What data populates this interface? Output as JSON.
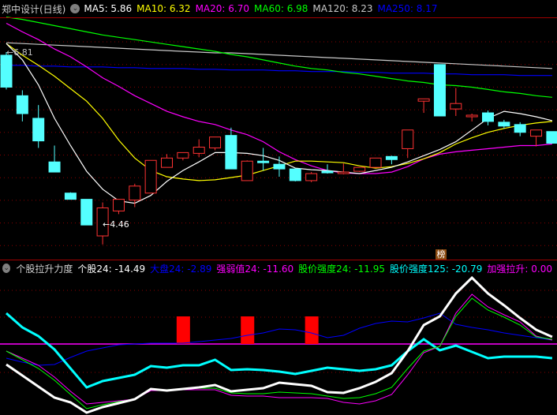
{
  "header": {
    "title": "郑中设计(日线)",
    "ma": [
      {
        "label": "MA5: 5.86",
        "color": "#ffffff"
      },
      {
        "label": "MA10: 6.32",
        "color": "#ffff00"
      },
      {
        "label": "MA20: 6.70",
        "color": "#ff00ff"
      },
      {
        "label": "MA60: 6.98",
        "color": "#00ff00"
      },
      {
        "label": "MA120: 8.23",
        "color": "#c8c8c8"
      },
      {
        "label": "MA250: 8.17",
        "color": "#0000ff"
      }
    ]
  },
  "indicator": {
    "title": "个股拉升力度",
    "items": [
      {
        "label": "个股24: -14.49",
        "color": "#ffffff"
      },
      {
        "label": "大盘24: -2.89",
        "color": "#0000ff"
      },
      {
        "label": "强弱值24: -11.60",
        "color": "#ff00ff"
      },
      {
        "label": "股价强度24: -11.95",
        "color": "#00ff00"
      },
      {
        "label": "股价强度125: -20.79",
        "color": "#00ffff"
      },
      {
        "label": "加强拉升: 0.00",
        "color": "#ff00ff"
      }
    ]
  },
  "labels": {
    "high": "←6.81",
    "low": "←4.46",
    "badge": "榜"
  },
  "colors": {
    "up": "#ff3232",
    "down": "#54ffff",
    "grid": "#8b0000"
  },
  "chart_data": [
    {
      "type": "candlestick",
      "title": "郑中设计(日线)",
      "price_high": 6.81,
      "price_low": 4.46,
      "candles": [
        [
          6.79,
          6.83,
          6.35,
          6.38
        ],
        [
          6.27,
          6.34,
          5.94,
          6.04
        ],
        [
          5.98,
          6.15,
          5.6,
          5.69
        ],
        [
          5.42,
          5.63,
          5.29,
          5.29
        ],
        [
          5.02,
          5.03,
          4.94,
          4.94
        ],
        [
          4.94,
          4.94,
          4.61,
          4.61
        ],
        [
          4.47,
          4.9,
          4.36,
          4.83
        ],
        [
          4.79,
          4.94,
          4.75,
          4.94
        ],
        [
          4.93,
          5.14,
          4.84,
          5.11
        ],
        [
          5.02,
          5.44,
          5.02,
          5.44
        ],
        [
          5.35,
          5.52,
          5.35,
          5.47
        ],
        [
          5.47,
          5.54,
          5.44,
          5.54
        ],
        [
          5.53,
          5.71,
          5.48,
          5.61
        ],
        [
          5.6,
          5.74,
          5.57,
          5.74
        ],
        [
          5.76,
          5.86,
          5.33,
          5.33
        ],
        [
          5.18,
          5.44,
          5.18,
          5.43
        ],
        [
          5.43,
          5.6,
          5.31,
          5.41
        ],
        [
          5.39,
          5.49,
          5.23,
          5.33
        ],
        [
          5.33,
          5.33,
          5.17,
          5.18
        ],
        [
          5.18,
          5.29,
          5.16,
          5.27
        ],
        [
          5.3,
          5.39,
          5.27,
          5.28
        ],
        [
          5.27,
          5.4,
          5.26,
          5.29
        ],
        [
          5.3,
          5.35,
          5.29,
          5.35
        ],
        [
          5.35,
          5.47,
          5.35,
          5.47
        ],
        [
          5.49,
          5.5,
          5.39,
          5.45
        ],
        [
          5.59,
          5.83,
          5.47,
          5.83
        ],
        [
          6.2,
          6.23,
          6.05,
          6.23
        ],
        [
          6.67,
          6.67,
          6.01,
          6.01
        ],
        [
          6.1,
          6.37,
          6.01,
          6.17
        ],
        [
          6.0,
          6.04,
          5.94,
          6.02
        ],
        [
          6.05,
          6.08,
          5.89,
          5.94
        ],
        [
          5.93,
          5.96,
          5.85,
          5.88
        ],
        [
          5.9,
          5.93,
          5.75,
          5.8
        ],
        [
          5.75,
          5.83,
          5.62,
          5.83
        ],
        [
          5.81,
          5.81,
          5.66,
          5.66
        ]
      ],
      "series": [
        {
          "name": "MA5",
          "color": "#ffffff",
          "values": [
            6.94,
            6.73,
            6.41,
            5.98,
            5.63,
            5.3,
            5.07,
            4.92,
            4.89,
            4.99,
            5.17,
            5.31,
            5.42,
            5.54,
            5.54,
            5.53,
            5.5,
            5.44,
            5.34,
            5.32,
            5.31,
            5.29,
            5.27,
            5.31,
            5.35,
            5.42,
            5.5,
            5.58,
            5.68,
            5.83,
            5.98,
            6.07,
            6.04,
            6.0,
            5.95
          ]
        },
        {
          "name": "MA10",
          "color": "#ffff00",
          "values": [
            6.94,
            6.79,
            6.66,
            6.52,
            6.36,
            6.2,
            5.98,
            5.7,
            5.47,
            5.31,
            5.23,
            5.2,
            5.18,
            5.19,
            5.22,
            5.25,
            5.31,
            5.37,
            5.43,
            5.43,
            5.42,
            5.41,
            5.37,
            5.34,
            5.36,
            5.4,
            5.46,
            5.54,
            5.65,
            5.73,
            5.8,
            5.85,
            5.89,
            5.92,
            5.94
          ]
        },
        {
          "name": "MA20",
          "color": "#ff00ff",
          "values": [
            7.2,
            7.09,
            6.99,
            6.87,
            6.77,
            6.64,
            6.5,
            6.39,
            6.27,
            6.17,
            6.07,
            6.0,
            5.94,
            5.9,
            5.83,
            5.77,
            5.68,
            5.55,
            5.45,
            5.37,
            5.31,
            5.28,
            5.27,
            5.27,
            5.29,
            5.36,
            5.46,
            5.52,
            5.55,
            5.57,
            5.59,
            5.61,
            5.63,
            5.63,
            5.65
          ]
        },
        {
          "name": "MA60",
          "color": "#00ff00",
          "values": [
            7.28,
            7.25,
            7.21,
            7.17,
            7.13,
            7.09,
            7.05,
            7.02,
            6.99,
            6.96,
            6.93,
            6.9,
            6.87,
            6.84,
            6.8,
            6.77,
            6.73,
            6.69,
            6.65,
            6.62,
            6.6,
            6.57,
            6.55,
            6.52,
            6.49,
            6.46,
            6.44,
            6.41,
            6.4,
            6.38,
            6.35,
            6.32,
            6.3,
            6.27,
            6.25
          ]
        },
        {
          "name": "MA120",
          "color": "#c8c8c8",
          "values": [
            6.95,
            6.94,
            6.93,
            6.92,
            6.91,
            6.9,
            6.89,
            6.88,
            6.87,
            6.86,
            6.85,
            6.84,
            6.83,
            6.82,
            6.82,
            6.81,
            6.8,
            6.79,
            6.78,
            6.77,
            6.76,
            6.75,
            6.74,
            6.73,
            6.72,
            6.71,
            6.7,
            6.69,
            6.68,
            6.67,
            6.66,
            6.65,
            6.64,
            6.63,
            6.62
          ]
        },
        {
          "name": "MA250",
          "color": "#0000ff",
          "values": [
            6.66,
            6.66,
            6.65,
            6.65,
            6.64,
            6.64,
            6.64,
            6.63,
            6.63,
            6.62,
            6.62,
            6.62,
            6.61,
            6.61,
            6.6,
            6.6,
            6.6,
            6.59,
            6.59,
            6.58,
            6.58,
            6.58,
            6.57,
            6.57,
            6.56,
            6.56,
            6.56,
            6.55,
            6.55,
            6.54,
            6.54,
            6.54,
            6.53,
            6.53,
            6.53
          ]
        }
      ]
    },
    {
      "type": "line",
      "title": "个股拉升力度",
      "series": [
        {
          "name": "大盘24",
          "color": "#0000ff",
          "width": 1,
          "values": [
            -18,
            -23,
            -27,
            -26,
            -17,
            -9,
            -5,
            -1,
            0,
            1,
            1,
            1,
            3,
            5,
            7,
            11,
            14,
            19,
            18,
            14,
            8,
            11,
            20,
            26,
            29,
            28,
            33,
            39,
            25,
            21,
            18,
            14,
            11,
            8,
            5
          ]
        },
        {
          "name": "股价强度125",
          "color": "#00ffff",
          "width": 3,
          "values": [
            39,
            21,
            10,
            -7,
            -31,
            -55,
            -47,
            -43,
            -39,
            -28,
            -30,
            -27,
            -27,
            -20,
            -33,
            -32,
            -33,
            -35,
            -38,
            -34,
            -30,
            -32,
            -34,
            -32,
            -27,
            -9,
            6,
            -8,
            -2,
            -10,
            -18,
            -16,
            -16,
            -16,
            -18
          ]
        },
        {
          "name": "强弱值24",
          "color": "#ff00ff",
          "width": 1,
          "values": [
            -9,
            -18,
            -27,
            -42,
            -60,
            -76,
            -74,
            -72,
            -70,
            -59,
            -59,
            -58,
            -58,
            -58,
            -65,
            -66,
            -66,
            -68,
            -68,
            -68,
            -69,
            -74,
            -76,
            -72,
            -64,
            -39,
            -11,
            -3,
            39,
            63,
            47,
            37,
            28,
            10,
            5
          ]
        },
        {
          "name": "股价强度24",
          "color": "#00ff00",
          "width": 1,
          "values": [
            -9,
            -20,
            -31,
            -46,
            -64,
            -82,
            -77,
            -73,
            -70,
            -58,
            -58,
            -57,
            -56,
            -56,
            -62,
            -63,
            -63,
            -61,
            -62,
            -63,
            -66,
            -69,
            -68,
            -63,
            -55,
            -31,
            -9,
            -3,
            35,
            58,
            43,
            34,
            24,
            9,
            6
          ]
        },
        {
          "name": "个股24",
          "color": "#ffffff",
          "width": 3,
          "values": [
            -26,
            -40,
            -54,
            -68,
            -74,
            -87,
            -80,
            -75,
            -70,
            -57,
            -59,
            -57,
            -55,
            -52,
            -60,
            -58,
            -56,
            -49,
            -51,
            -53,
            -61,
            -62,
            -56,
            -48,
            -37,
            -9,
            24,
            35,
            64,
            84,
            64,
            49,
            33,
            18,
            9
          ]
        }
      ],
      "bars": {
        "name": "加强拉升",
        "color": "#ff0000",
        "values": [
          0,
          0,
          0,
          0,
          0,
          0,
          0,
          0,
          0,
          0,
          0,
          35,
          0,
          0,
          0,
          35,
          0,
          0,
          0,
          35,
          0,
          0,
          0,
          0,
          0,
          0,
          0,
          0,
          0,
          0,
          0,
          0,
          0,
          0,
          0
        ]
      }
    }
  ]
}
